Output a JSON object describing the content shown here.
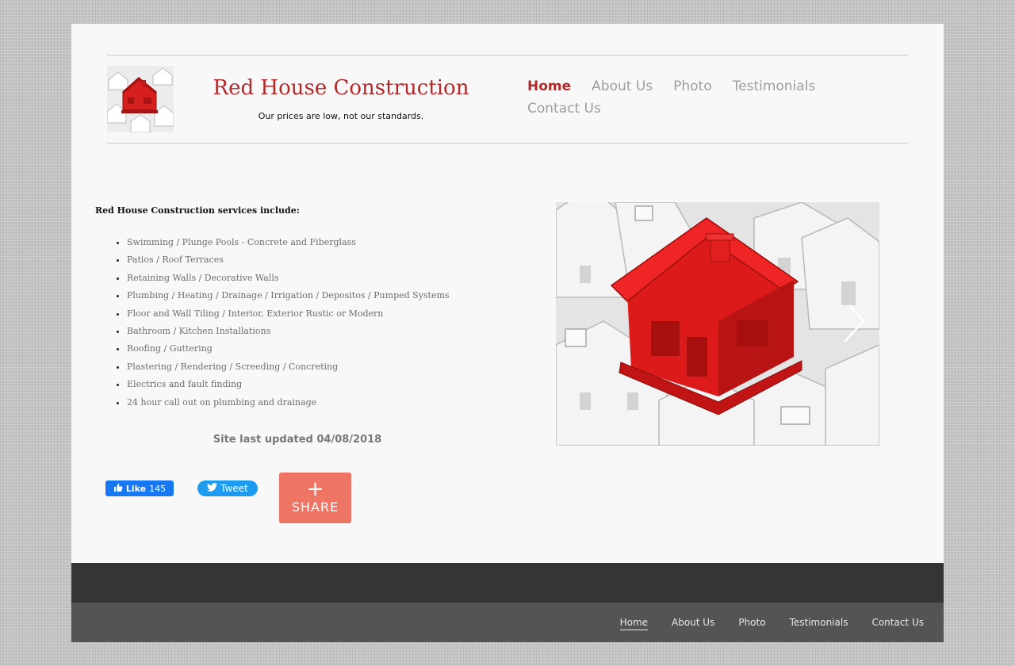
{
  "header": {
    "title": "Red House Construction",
    "tagline": "Our prices are low, not our standards."
  },
  "nav": {
    "items": [
      {
        "label": "Home",
        "active": true
      },
      {
        "label": "About Us"
      },
      {
        "label": "Photo"
      },
      {
        "label": "Testimonials"
      },
      {
        "label": "Contact Us"
      }
    ]
  },
  "services": {
    "heading": "Red House Construction services include:",
    "items": [
      "Swimming / Plunge Pools - Concrete and Fiberglass",
      "Patios / Roof Terraces",
      "Retaining Walls / Decorative Walls",
      "Plumbing / Heating / Drainage / Irrigation / Depositos / Pumped Systems",
      "Floor and Wall Tiling / Interior, Exterior Rustic or Modern",
      "Bathroom / Kitchen Installations",
      "Roofing / Guttering",
      "Plastering / Rendering / Screeding / Concreting",
      "Electrics and fault finding",
      "24 hour call out on plumbing and drainage"
    ]
  },
  "updated": "Site last updated 04/08/2018",
  "social": {
    "like_label": "Like",
    "like_count": "145",
    "tweet_label": "Tweet",
    "share_plus": "+",
    "share_label": "SHARE"
  },
  "footer": {
    "nav": [
      "Home",
      "About Us",
      "Photo",
      "Testimonials",
      "Contact Us"
    ]
  },
  "colors": {
    "accent": "#b12a2a",
    "share": "#ee7564",
    "facebook": "#1877f2",
    "twitter": "#1d9bf0"
  },
  "icons": {
    "logo": "red-house-icon",
    "slide_next": "chevron-right-icon"
  }
}
